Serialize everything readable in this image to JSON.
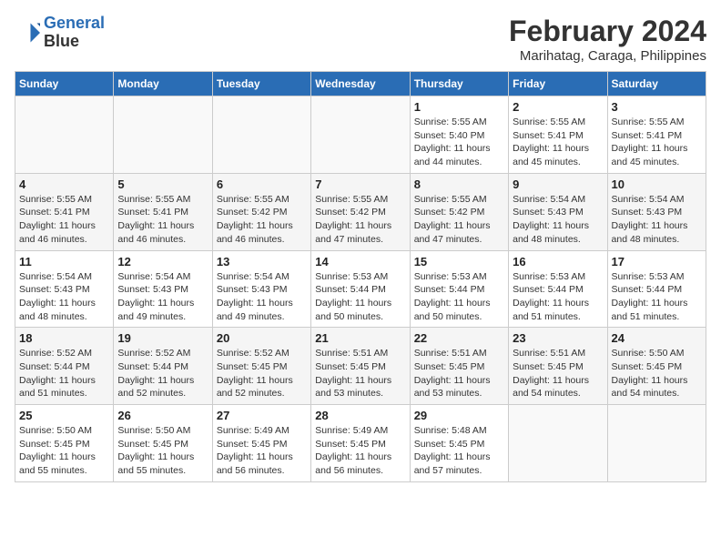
{
  "app": {
    "name_line1": "General",
    "name_line2": "Blue"
  },
  "calendar": {
    "title": "February 2024",
    "subtitle": "Marihatag, Caraga, Philippines",
    "days_of_week": [
      "Sunday",
      "Monday",
      "Tuesday",
      "Wednesday",
      "Thursday",
      "Friday",
      "Saturday"
    ],
    "weeks": [
      [
        {
          "day": "",
          "info": ""
        },
        {
          "day": "",
          "info": ""
        },
        {
          "day": "",
          "info": ""
        },
        {
          "day": "",
          "info": ""
        },
        {
          "day": "1",
          "info": "Sunrise: 5:55 AM\nSunset: 5:40 PM\nDaylight: 11 hours\nand 44 minutes."
        },
        {
          "day": "2",
          "info": "Sunrise: 5:55 AM\nSunset: 5:41 PM\nDaylight: 11 hours\nand 45 minutes."
        },
        {
          "day": "3",
          "info": "Sunrise: 5:55 AM\nSunset: 5:41 PM\nDaylight: 11 hours\nand 45 minutes."
        }
      ],
      [
        {
          "day": "4",
          "info": "Sunrise: 5:55 AM\nSunset: 5:41 PM\nDaylight: 11 hours\nand 46 minutes."
        },
        {
          "day": "5",
          "info": "Sunrise: 5:55 AM\nSunset: 5:41 PM\nDaylight: 11 hours\nand 46 minutes."
        },
        {
          "day": "6",
          "info": "Sunrise: 5:55 AM\nSunset: 5:42 PM\nDaylight: 11 hours\nand 46 minutes."
        },
        {
          "day": "7",
          "info": "Sunrise: 5:55 AM\nSunset: 5:42 PM\nDaylight: 11 hours\nand 47 minutes."
        },
        {
          "day": "8",
          "info": "Sunrise: 5:55 AM\nSunset: 5:42 PM\nDaylight: 11 hours\nand 47 minutes."
        },
        {
          "day": "9",
          "info": "Sunrise: 5:54 AM\nSunset: 5:43 PM\nDaylight: 11 hours\nand 48 minutes."
        },
        {
          "day": "10",
          "info": "Sunrise: 5:54 AM\nSunset: 5:43 PM\nDaylight: 11 hours\nand 48 minutes."
        }
      ],
      [
        {
          "day": "11",
          "info": "Sunrise: 5:54 AM\nSunset: 5:43 PM\nDaylight: 11 hours\nand 48 minutes."
        },
        {
          "day": "12",
          "info": "Sunrise: 5:54 AM\nSunset: 5:43 PM\nDaylight: 11 hours\nand 49 minutes."
        },
        {
          "day": "13",
          "info": "Sunrise: 5:54 AM\nSunset: 5:43 PM\nDaylight: 11 hours\nand 49 minutes."
        },
        {
          "day": "14",
          "info": "Sunrise: 5:53 AM\nSunset: 5:44 PM\nDaylight: 11 hours\nand 50 minutes."
        },
        {
          "day": "15",
          "info": "Sunrise: 5:53 AM\nSunset: 5:44 PM\nDaylight: 11 hours\nand 50 minutes."
        },
        {
          "day": "16",
          "info": "Sunrise: 5:53 AM\nSunset: 5:44 PM\nDaylight: 11 hours\nand 51 minutes."
        },
        {
          "day": "17",
          "info": "Sunrise: 5:53 AM\nSunset: 5:44 PM\nDaylight: 11 hours\nand 51 minutes."
        }
      ],
      [
        {
          "day": "18",
          "info": "Sunrise: 5:52 AM\nSunset: 5:44 PM\nDaylight: 11 hours\nand 51 minutes."
        },
        {
          "day": "19",
          "info": "Sunrise: 5:52 AM\nSunset: 5:44 PM\nDaylight: 11 hours\nand 52 minutes."
        },
        {
          "day": "20",
          "info": "Sunrise: 5:52 AM\nSunset: 5:45 PM\nDaylight: 11 hours\nand 52 minutes."
        },
        {
          "day": "21",
          "info": "Sunrise: 5:51 AM\nSunset: 5:45 PM\nDaylight: 11 hours\nand 53 minutes."
        },
        {
          "day": "22",
          "info": "Sunrise: 5:51 AM\nSunset: 5:45 PM\nDaylight: 11 hours\nand 53 minutes."
        },
        {
          "day": "23",
          "info": "Sunrise: 5:51 AM\nSunset: 5:45 PM\nDaylight: 11 hours\nand 54 minutes."
        },
        {
          "day": "24",
          "info": "Sunrise: 5:50 AM\nSunset: 5:45 PM\nDaylight: 11 hours\nand 54 minutes."
        }
      ],
      [
        {
          "day": "25",
          "info": "Sunrise: 5:50 AM\nSunset: 5:45 PM\nDaylight: 11 hours\nand 55 minutes."
        },
        {
          "day": "26",
          "info": "Sunrise: 5:50 AM\nSunset: 5:45 PM\nDaylight: 11 hours\nand 55 minutes."
        },
        {
          "day": "27",
          "info": "Sunrise: 5:49 AM\nSunset: 5:45 PM\nDaylight: 11 hours\nand 56 minutes."
        },
        {
          "day": "28",
          "info": "Sunrise: 5:49 AM\nSunset: 5:45 PM\nDaylight: 11 hours\nand 56 minutes."
        },
        {
          "day": "29",
          "info": "Sunrise: 5:48 AM\nSunset: 5:45 PM\nDaylight: 11 hours\nand 57 minutes."
        },
        {
          "day": "",
          "info": ""
        },
        {
          "day": "",
          "info": ""
        }
      ]
    ]
  }
}
